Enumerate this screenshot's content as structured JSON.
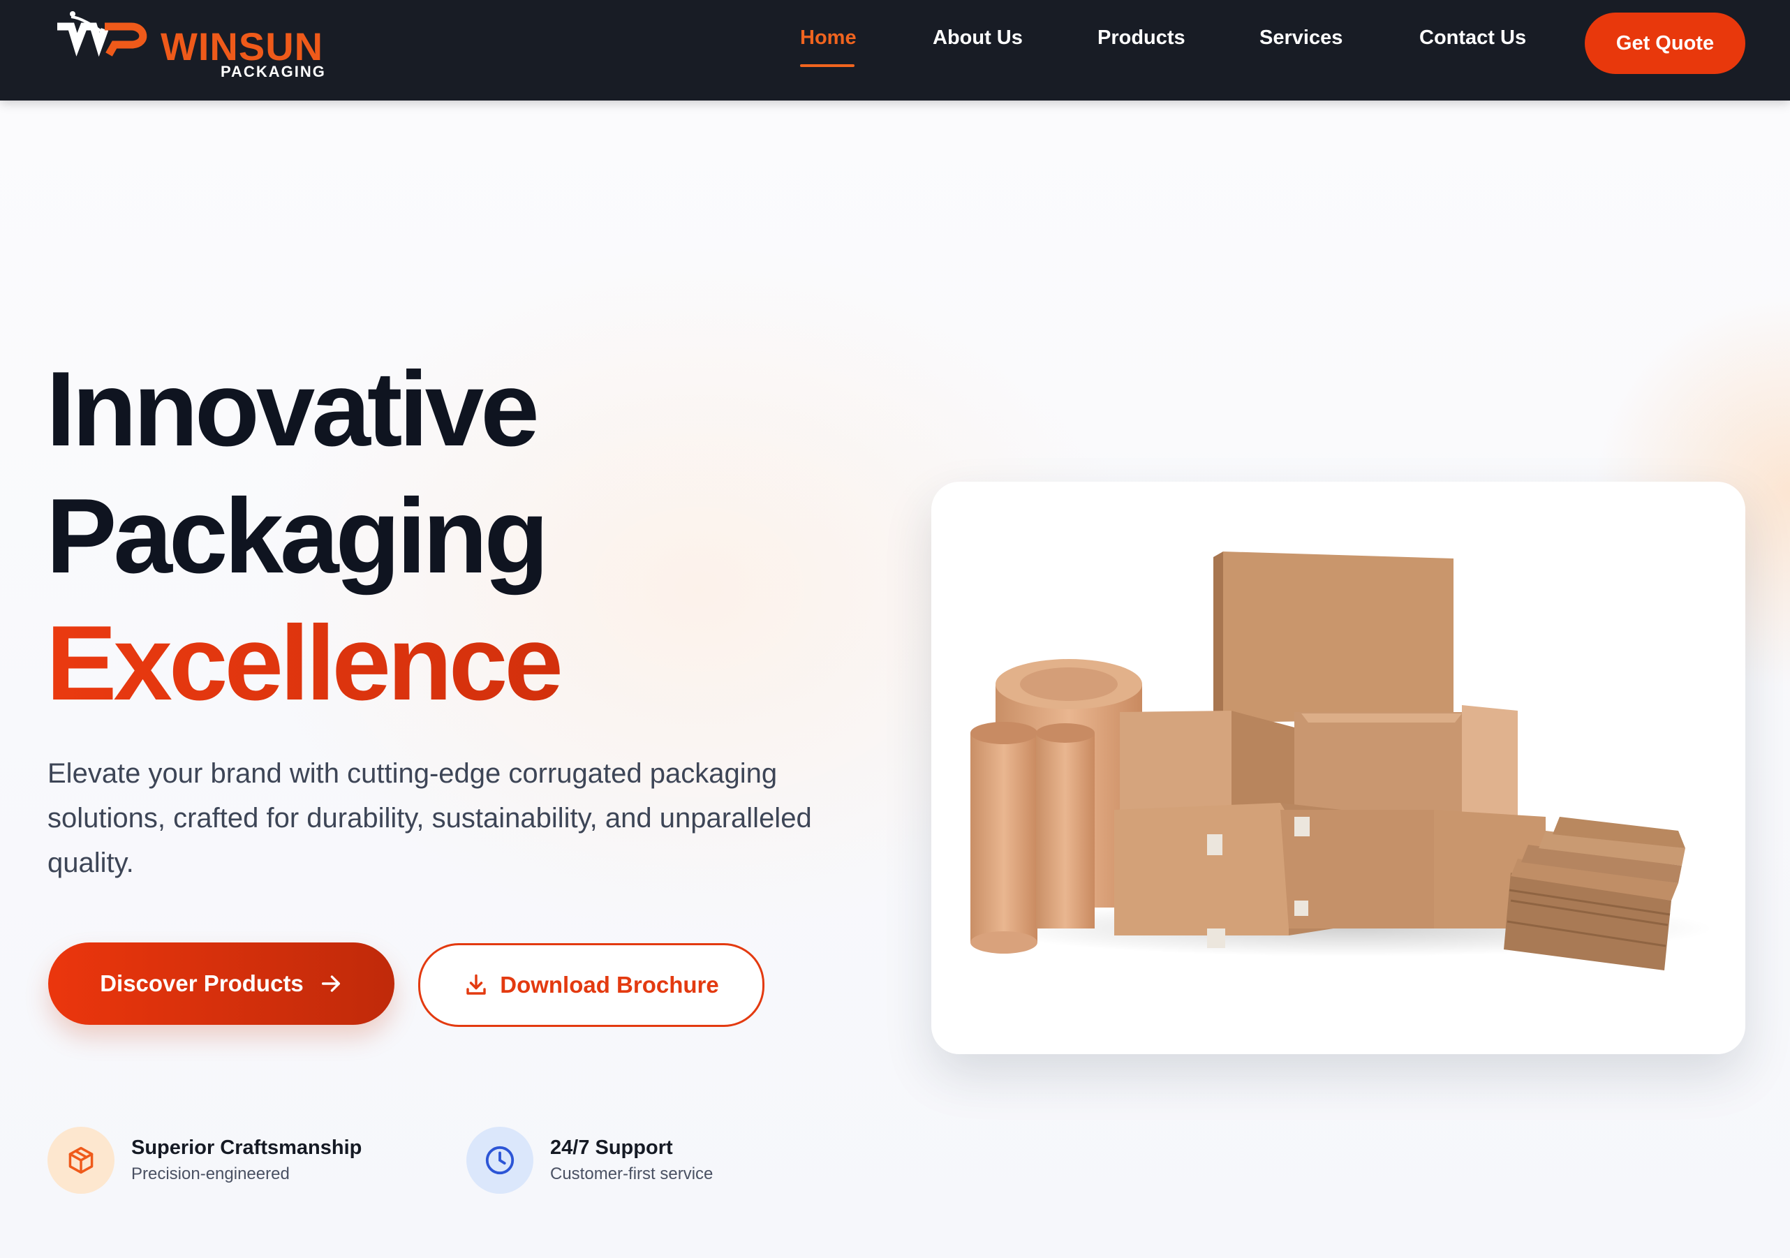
{
  "brand": {
    "name": "WINSUN",
    "sub": "PACKAGING",
    "mark": "WP",
    "color_accent": "#ef5a1a"
  },
  "nav": {
    "items": [
      {
        "label": "Home",
        "active": true
      },
      {
        "label": "About Us"
      },
      {
        "label": "Products"
      },
      {
        "label": "Services"
      },
      {
        "label": "Contact Us"
      }
    ],
    "cta": "Get Quote"
  },
  "hero": {
    "line1": "Innovative",
    "line2": "Packaging",
    "line3": "Excellence",
    "lead": "Elevate your brand with cutting-edge corrugated packaging solutions, crafted for durability, sustainability, and unparalleled quality.",
    "primary_button": "Discover Products",
    "primary_icon": "arrow-right-icon",
    "secondary_button": "Download Brochure",
    "secondary_icon": "download-icon"
  },
  "features": [
    {
      "title": "Superior Craftsmanship",
      "desc": "Precision-engineered",
      "icon": "box-icon",
      "bg": "#fde7cf",
      "fg": "#ef5a1a"
    },
    {
      "title": "24/7 Support",
      "desc": "Customer-first service",
      "icon": "clock-icon",
      "bg": "#dbe7fb",
      "fg": "#2c55d6"
    }
  ],
  "image": {
    "subject": "corrugated-boxes-image"
  }
}
